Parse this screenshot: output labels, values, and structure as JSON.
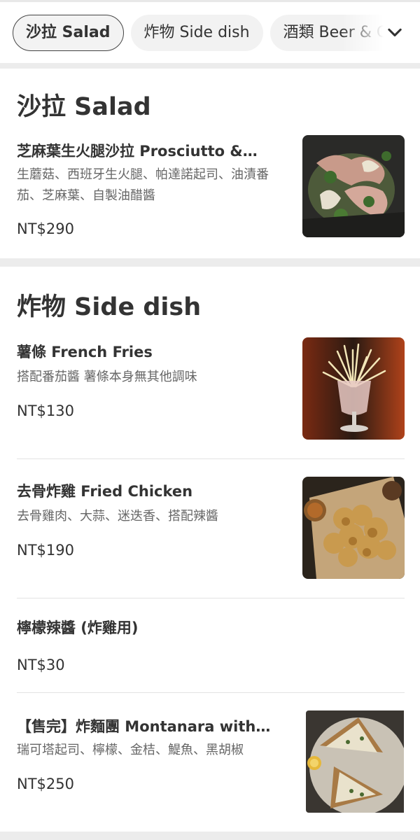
{
  "tabs": [
    {
      "label": "沙拉 Salad",
      "active": true
    },
    {
      "label": "炸物 Side dish",
      "active": false
    },
    {
      "label": "酒類 Beer & C",
      "active": false
    }
  ],
  "sections": {
    "salad": {
      "title": "沙拉 Salad",
      "items": [
        {
          "name": "芝麻葉生火腿沙拉 Prosciutto &…",
          "desc": "生蘑菇、西班牙生火腿、帕達諾起司、油漬番茄、芝麻葉、自製油醋醬",
          "price": "NT$290"
        }
      ]
    },
    "side": {
      "title": "炸物 Side dish",
      "items": [
        {
          "name": "薯條 French Fries",
          "desc": "搭配番茄醬 薯條本身無其他調味",
          "price": "NT$130"
        },
        {
          "name": "去骨炸雞 Fried Chicken",
          "desc": "去骨雞肉、大蒜、迷迭香、搭配辣醬",
          "price": "NT$190"
        },
        {
          "name": "檸檬辣醬 (炸雞用)",
          "desc": "",
          "price": "NT$30"
        },
        {
          "name": "【售完】炸麵團 Montanara with…",
          "desc": "瑞可塔起司、檸檬、金桔、鯷魚、黑胡椒",
          "price": "NT$250"
        }
      ]
    }
  },
  "icons": {
    "chevron": "chevron-down-icon"
  },
  "colors": {
    "accent_border": "#444444",
    "gap": "#ececec"
  }
}
